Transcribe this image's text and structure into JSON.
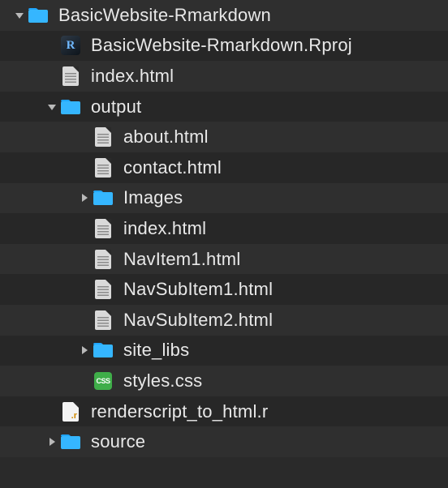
{
  "tree": [
    {
      "depth": 0,
      "arrow": "down",
      "icon": "folder",
      "label": "BasicWebsite-Rmarkdown"
    },
    {
      "depth": 1,
      "arrow": "none",
      "icon": "rproj",
      "label": "BasicWebsite-Rmarkdown.Rproj"
    },
    {
      "depth": 1,
      "arrow": "none",
      "icon": "doc",
      "label": "index.html"
    },
    {
      "depth": 1,
      "arrow": "down",
      "icon": "folder",
      "label": "output"
    },
    {
      "depth": 2,
      "arrow": "none",
      "icon": "doc",
      "label": "about.html"
    },
    {
      "depth": 2,
      "arrow": "none",
      "icon": "doc",
      "label": "contact.html"
    },
    {
      "depth": 2,
      "arrow": "right",
      "icon": "folder",
      "label": "Images"
    },
    {
      "depth": 2,
      "arrow": "none",
      "icon": "doc",
      "label": "index.html"
    },
    {
      "depth": 2,
      "arrow": "none",
      "icon": "doc",
      "label": "NavItem1.html"
    },
    {
      "depth": 2,
      "arrow": "none",
      "icon": "doc",
      "label": "NavSubItem1.html"
    },
    {
      "depth": 2,
      "arrow": "none",
      "icon": "doc",
      "label": "NavSubItem2.html"
    },
    {
      "depth": 2,
      "arrow": "right",
      "icon": "folder",
      "label": "site_libs"
    },
    {
      "depth": 2,
      "arrow": "none",
      "icon": "css",
      "label": "styles.css"
    },
    {
      "depth": 1,
      "arrow": "none",
      "icon": "rscript",
      "label": "renderscript_to_html.r"
    },
    {
      "depth": 1,
      "arrow": "right",
      "icon": "folder",
      "label": "source"
    }
  ],
  "indent_base": 14,
  "indent_step": 40
}
